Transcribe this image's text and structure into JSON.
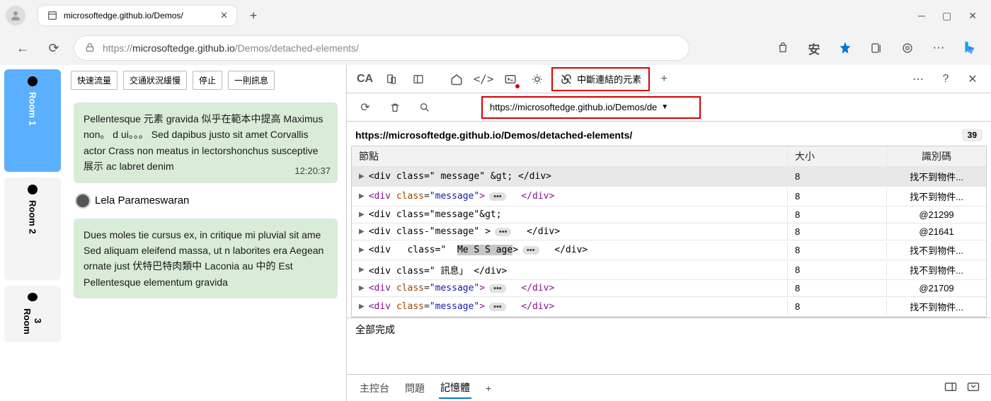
{
  "browser": {
    "tab_title": "microsoftedge.github.io/Demos/",
    "url_prefix": "https://",
    "url_host": "microsoftedge.github.io",
    "url_path": "/Demos/detached-elements/",
    "security_label": "安"
  },
  "app": {
    "rooms": [
      {
        "label": "Room 1",
        "active": true
      },
      {
        "label": "Room 2",
        "active": false
      },
      {
        "label": "Room 3",
        "active": false
      }
    ],
    "toolbar": {
      "fast": "快速流量",
      "slow": "交通狀況緩慢",
      "stop": "停止",
      "onemsg": "一則訊息"
    },
    "msg1": {
      "text": "Pellentesque 元素 gravida 似乎在範本中提高 Maximus non。 d ui。。。 Sed dapibus justo sit amet Corvallis actor        Crass non meatus in lectorshonchus susceptive 展示 ac labret denim",
      "time": "12:20:37"
    },
    "author2": "Lela Parameswaran",
    "msg2": {
      "text": "Dues moles tie cursus ex,   in critique mi pluvial sit ame       Sed aliquam eleifend massa, ut n laborites era Aegean ornate just 伏特巴特肉類中 Laconia  au 中的 Est Pellentesque elementum gravida"
    }
  },
  "devtools": {
    "tab_label_CA": "CA",
    "tab_detached": "中斷連結的元素",
    "url_filter": "https://microsoftedge.github.io/Demos/de",
    "page_url": "https://microsoftedge.github.io/Demos/detached-elements/",
    "badge": "39",
    "headers": {
      "node": "節點",
      "size": "大小",
      "id": "識別碼"
    },
    "notfound": "找不到物件...",
    "rows": [
      {
        "html": "<div   class=\"   message\" &gt;  </div>",
        "size": "8",
        "id": "找不到物件...",
        "pill": false,
        "sel": true
      },
      {
        "html": "<div  class=\"message\"> ••• </div>",
        "size": "8",
        "id": "找不到物件...",
        "pill": true,
        "styled": true
      },
      {
        "html": "<div   class=\"message\"&gt;",
        "size": "8",
        "id": "@21299"
      },
      {
        "html": "<div   class-\"message\"  > ••• </div>",
        "size": "8",
        "id": "@21641",
        "pill": true
      },
      {
        "html": "<div   class=\"  Me S S age > ••• </div>",
        "size": "8",
        "id": "找不到物件...",
        "pill": true,
        "highlight": "Me S S age"
      },
      {
        "html": "<div   class=\"   訊息」    </div>",
        "size": "8",
        "id": "找不到物件..."
      },
      {
        "html": "<div  class=\"message\"> ••• </div>",
        "size": "8",
        "id": "@21709",
        "pill": true,
        "styled": true
      },
      {
        "html": "<div   class=\"  message\"> ••• </div>",
        "size": "8",
        "id": "找不到物件...",
        "pill": true,
        "styled": true
      }
    ],
    "status": "全部完成",
    "bottom_tabs": {
      "console": "主控台",
      "issues": "問題",
      "memory": "記憶體"
    }
  }
}
